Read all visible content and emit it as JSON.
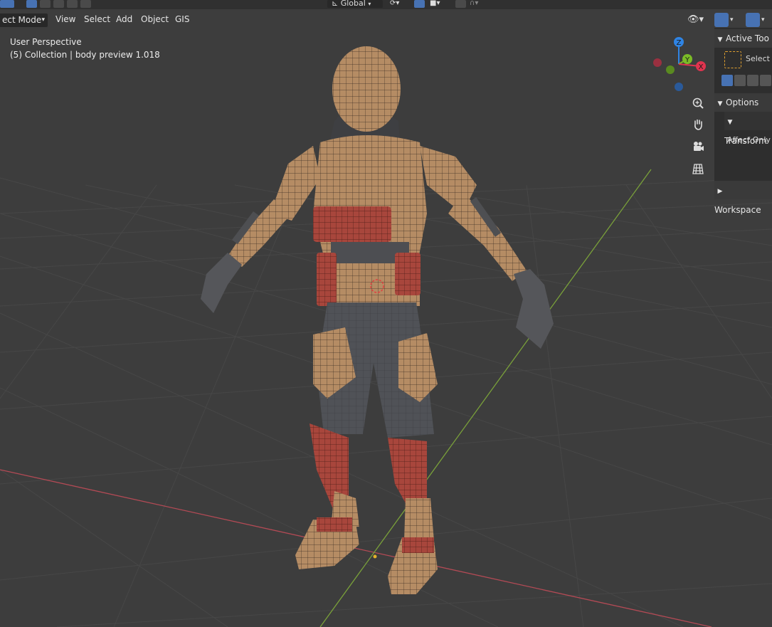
{
  "header": {
    "mode_label": "ect Mode",
    "menus": [
      "View",
      "Select",
      "Add",
      "Object",
      "GIS"
    ],
    "orientation_label": "Global"
  },
  "overlay": {
    "perspective": "User Perspective",
    "collection": "(5) Collection | body preview 1.018"
  },
  "gizmo": {
    "z_label": "Z",
    "y_label": "Y",
    "x_label": "X",
    "colors": {
      "x": "#e0344f",
      "y": "#7bbb27",
      "z": "#2f84e4"
    }
  },
  "npanel": {
    "active_tool_title": "Active Too",
    "select_label": "Select B",
    "options_title": "Options",
    "transform_title": "Transform",
    "affect_only_label": "Affect Only",
    "workspace_title": "Workspace"
  },
  "colors": {
    "viewport_bg": "#3d3d3d",
    "grid_line": "#464646",
    "x_axis": "#b34a55",
    "y_axis": "#7aa13a",
    "accent": "#4772b3",
    "mesh_skin": "#b08a63",
    "mesh_red": "#a9443b",
    "mesh_dark": "#4e4f52"
  },
  "icons": [
    "select-tool-icon",
    "zoom-icon",
    "pan-hand-icon",
    "camera-icon",
    "grid-ortho-icon",
    "visibility-icon",
    "gizmo-toggle-icon",
    "overlay-toggle-icon"
  ]
}
